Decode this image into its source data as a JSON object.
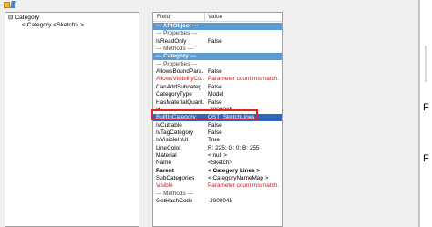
{
  "tree": {
    "items": [
      {
        "label": "Category"
      },
      {
        "label": "< Category <Sketch> >"
      }
    ],
    "methods_label": "Methods"
  },
  "grid": {
    "header": {
      "field": "Field",
      "value": "Value"
    },
    "rows": [
      {
        "kind": "section",
        "field": "--- APIObject ---",
        "value": ""
      },
      {
        "kind": "group",
        "field": "--- Properties ---",
        "value": ""
      },
      {
        "kind": "normal",
        "field": "IsReadOnly",
        "value": "False"
      },
      {
        "kind": "group",
        "field": "--- Methods ---",
        "value": ""
      },
      {
        "kind": "section",
        "field": "--- Category ---",
        "value": ""
      },
      {
        "kind": "group",
        "field": "--- Properties ---",
        "value": ""
      },
      {
        "kind": "normal",
        "field": "AllowsBoundPara...",
        "value": "False"
      },
      {
        "kind": "red",
        "field": "AllowsVisibilityCo...",
        "value": "Parameter count mismatch."
      },
      {
        "kind": "normal",
        "field": "CanAddSubcateg...",
        "value": "False"
      },
      {
        "kind": "normal",
        "field": "CategoryType",
        "value": "Model"
      },
      {
        "kind": "normal",
        "field": "HasMaterialQuant...",
        "value": "False"
      },
      {
        "kind": "normal",
        "field": "Id",
        "value": "-2000045"
      },
      {
        "kind": "selected",
        "field": "BuiltInCategory",
        "value": "OST_SketchLines"
      },
      {
        "kind": "normal",
        "field": "IsCuttable",
        "value": "False"
      },
      {
        "kind": "normal",
        "field": "IsTagCategory",
        "value": "False"
      },
      {
        "kind": "normal",
        "field": "IsVisibleInUI",
        "value": "True"
      },
      {
        "kind": "normal",
        "field": "LineColor",
        "value": "R: 225; G: 0; B: 255"
      },
      {
        "kind": "normal",
        "field": "Material",
        "value": "< null >"
      },
      {
        "kind": "normal",
        "field": "Name",
        "value": "<Sketch>"
      },
      {
        "kind": "bold",
        "field": "Parent",
        "value": "< Category Lines >"
      },
      {
        "kind": "normal",
        "field": "SubCategories",
        "value": "< CategoryNameMap >"
      },
      {
        "kind": "red",
        "field": "Visible",
        "value": "Parameter count mismatch."
      },
      {
        "kind": "group",
        "field": "--- Methods ---",
        "value": ""
      },
      {
        "kind": "normal",
        "field": "GetHashCode",
        "value": "-2000045"
      }
    ]
  },
  "right_panel": {
    "text_a": "F",
    "text_b": "F"
  },
  "colors": {
    "section": "#5b9bd5",
    "selected": "#2f66c0",
    "highlight": "#e0241e",
    "error": "#d31818"
  }
}
